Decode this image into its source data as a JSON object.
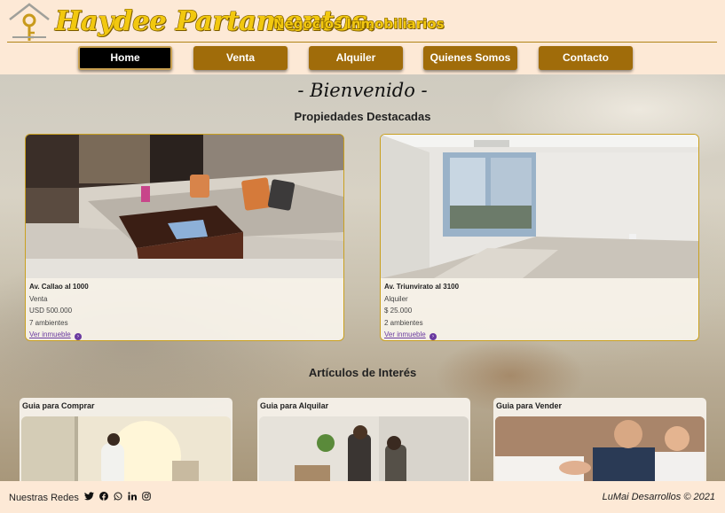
{
  "header": {
    "brand": "Haydee Partamentos.",
    "tagline": "Negocios Inmobiliarios"
  },
  "nav": {
    "items": [
      {
        "label": "Home",
        "active": true
      },
      {
        "label": "Venta",
        "active": false
      },
      {
        "label": "Alquiler",
        "active": false
      },
      {
        "label": "Quienes Somos",
        "active": false
      },
      {
        "label": "Contacto",
        "active": false
      }
    ]
  },
  "main": {
    "welcome": "- Bienvenido -",
    "featured_title": "Propiedades Destacadas",
    "properties": [
      {
        "address": "Av. Callao al 1000",
        "type": "Venta",
        "price": "USD 500.000",
        "rooms": "7 ambientes",
        "link": "Ver inmueble"
      },
      {
        "address": "Av. Triunvirato al 3100",
        "type": "Alquiler",
        "price": "$ 25.000",
        "rooms": "2 ambientes",
        "link": "Ver inmueble"
      }
    ],
    "articles_title": "Artículos de Interés",
    "articles": [
      {
        "title": "Guia para Comprar"
      },
      {
        "title": "Guia para Alquilar"
      },
      {
        "title": "Guia para Vender"
      }
    ]
  },
  "footer": {
    "social_label": "Nuestras Redes",
    "social_icons": [
      "twitter-icon",
      "facebook-icon",
      "whatsapp-icon",
      "linkedin-icon",
      "instagram-icon"
    ],
    "copyright": "LuMai Desarrollos © 2021"
  },
  "colors": {
    "background": "#fde9d6",
    "nav_button": "#a06c0a",
    "nav_active": "#000000",
    "brand": "#f2c80f",
    "card_border": "#c9a020"
  }
}
